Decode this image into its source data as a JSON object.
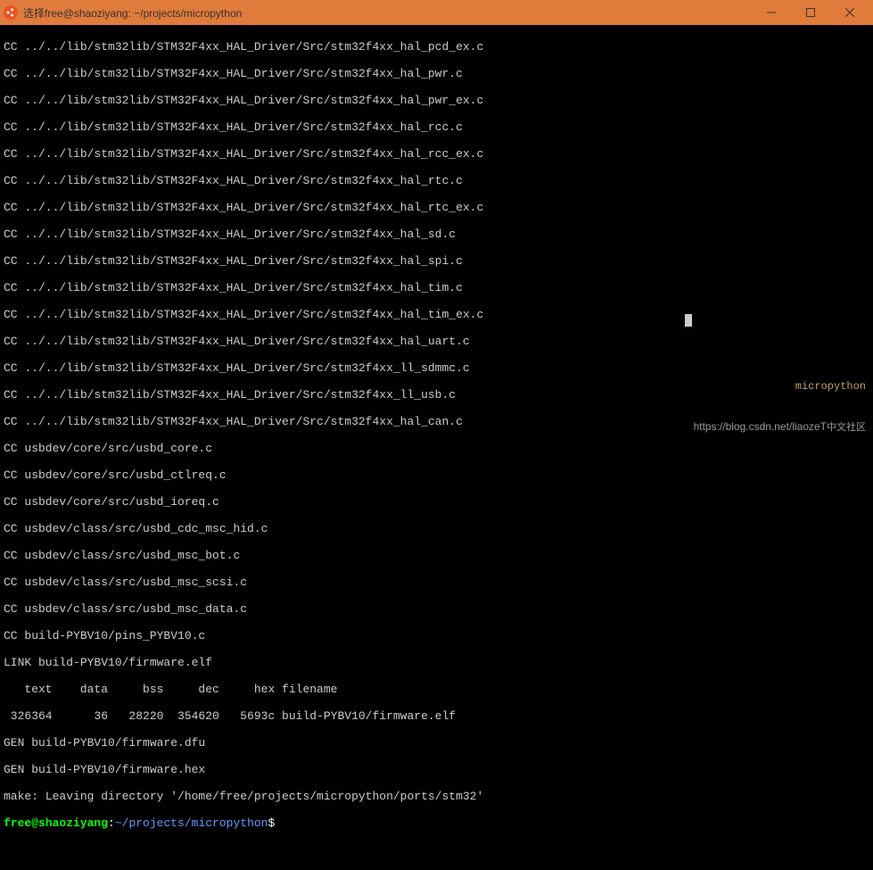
{
  "titlebar": {
    "title": "选择free@shaoziyang: ~/projects/micropython"
  },
  "lines": [
    "CC ../../lib/stm32lib/STM32F4xx_HAL_Driver/Src/stm32f4xx_hal_pcd_ex.c",
    "CC ../../lib/stm32lib/STM32F4xx_HAL_Driver/Src/stm32f4xx_hal_pwr.c",
    "CC ../../lib/stm32lib/STM32F4xx_HAL_Driver/Src/stm32f4xx_hal_pwr_ex.c",
    "CC ../../lib/stm32lib/STM32F4xx_HAL_Driver/Src/stm32f4xx_hal_rcc.c",
    "CC ../../lib/stm32lib/STM32F4xx_HAL_Driver/Src/stm32f4xx_hal_rcc_ex.c",
    "CC ../../lib/stm32lib/STM32F4xx_HAL_Driver/Src/stm32f4xx_hal_rtc.c",
    "CC ../../lib/stm32lib/STM32F4xx_HAL_Driver/Src/stm32f4xx_hal_rtc_ex.c",
    "CC ../../lib/stm32lib/STM32F4xx_HAL_Driver/Src/stm32f4xx_hal_sd.c",
    "CC ../../lib/stm32lib/STM32F4xx_HAL_Driver/Src/stm32f4xx_hal_spi.c",
    "CC ../../lib/stm32lib/STM32F4xx_HAL_Driver/Src/stm32f4xx_hal_tim.c",
    "CC ../../lib/stm32lib/STM32F4xx_HAL_Driver/Src/stm32f4xx_hal_tim_ex.c",
    "CC ../../lib/stm32lib/STM32F4xx_HAL_Driver/Src/stm32f4xx_hal_uart.c",
    "CC ../../lib/stm32lib/STM32F4xx_HAL_Driver/Src/stm32f4xx_ll_sdmmc.c",
    "CC ../../lib/stm32lib/STM32F4xx_HAL_Driver/Src/stm32f4xx_ll_usb.c",
    "CC ../../lib/stm32lib/STM32F4xx_HAL_Driver/Src/stm32f4xx_hal_can.c",
    "CC usbdev/core/src/usbd_core.c",
    "CC usbdev/core/src/usbd_ctlreq.c",
    "CC usbdev/core/src/usbd_ioreq.c",
    "CC usbdev/class/src/usbd_cdc_msc_hid.c",
    "CC usbdev/class/src/usbd_msc_bot.c",
    "CC usbdev/class/src/usbd_msc_scsi.c",
    "CC usbdev/class/src/usbd_msc_data.c",
    "CC build-PYBV10/pins_PYBV10.c",
    "LINK build-PYBV10/firmware.elf",
    "   text    data     bss     dec     hex filename",
    " 326364      36   28220  354620   5693c build-PYBV10/firmware.elf",
    "GEN build-PYBV10/firmware.dfu",
    "GEN build-PYBV10/firmware.hex",
    "make: Leaving directory '/home/free/projects/micropython/ports/stm32'"
  ],
  "prompt": {
    "user": "free@shaoziyang",
    "colon": ":",
    "path": "~/projects/micropython",
    "dollar": "$"
  },
  "watermark": {
    "mp": "micropython",
    "url": "https://blog.csdn.net/liaozeT",
    "cn": "中文社区"
  }
}
